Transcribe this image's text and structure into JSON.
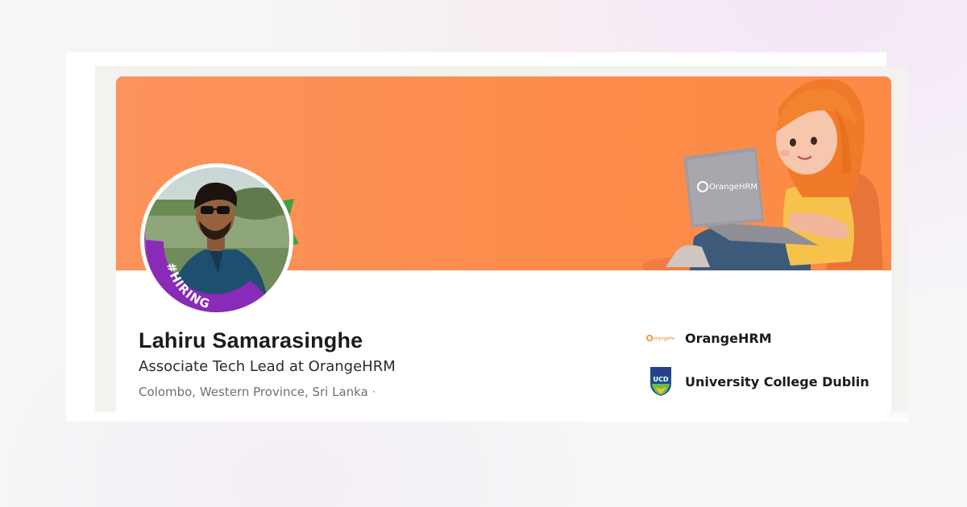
{
  "profile": {
    "name": "Lahiru Samarasinghe",
    "headline": "Associate Tech Lead at OrangeHRM",
    "location": "Colombo, Western Province, Sri Lanka ·",
    "frame_text": "#HIRING"
  },
  "laptop_brand": "OrangeHRM",
  "orgs": [
    {
      "name": "OrangeHRM",
      "icon": "orangehrm-logo",
      "logo_text": "orangehrm"
    },
    {
      "name": "University College Dublin",
      "icon": "ucd-crest-logo",
      "logo_text": "UCD"
    }
  ],
  "colors": {
    "banner": "#fd8c4a",
    "hiring_frame": "#8a2ab8",
    "badge_green": "#3fa142",
    "name_text": "#1b1b1b"
  }
}
